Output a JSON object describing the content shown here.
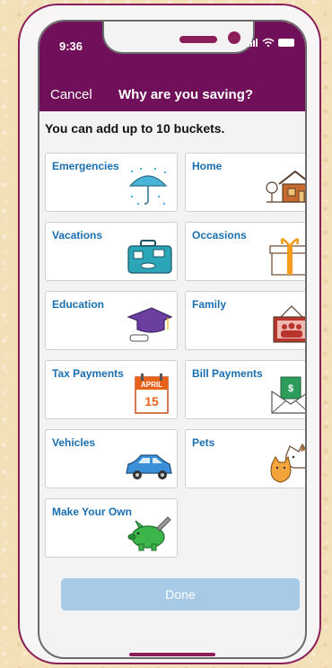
{
  "status": {
    "time": "9:36"
  },
  "nav": {
    "cancel": "Cancel",
    "title": "Why are you saving?"
  },
  "intro": "You can add up to 10 buckets.",
  "buckets": [
    {
      "label": "Emergencies",
      "icon": "umbrella-icon"
    },
    {
      "label": "Home",
      "icon": "house-icon"
    },
    {
      "label": "Vacations",
      "icon": "suitcase-icon"
    },
    {
      "label": "Occasions",
      "icon": "gift-icon"
    },
    {
      "label": "Education",
      "icon": "graduation-cap-icon"
    },
    {
      "label": "Family",
      "icon": "family-photo-icon"
    },
    {
      "label": "Tax Payments",
      "icon": "calendar-icon",
      "calendar_month": "APRIL",
      "calendar_day": "15"
    },
    {
      "label": "Bill Payments",
      "icon": "envelope-dollar-icon",
      "dollar_sign": "$"
    },
    {
      "label": "Vehicles",
      "icon": "car-icon"
    },
    {
      "label": "Pets",
      "icon": "pets-icon"
    },
    {
      "label": "Make Your Own",
      "icon": "piggy-bank-icon"
    }
  ],
  "done_label": "Done",
  "colors": {
    "brand": "#71105a",
    "link": "#1a6fb0",
    "done": "#a7cbe7"
  }
}
